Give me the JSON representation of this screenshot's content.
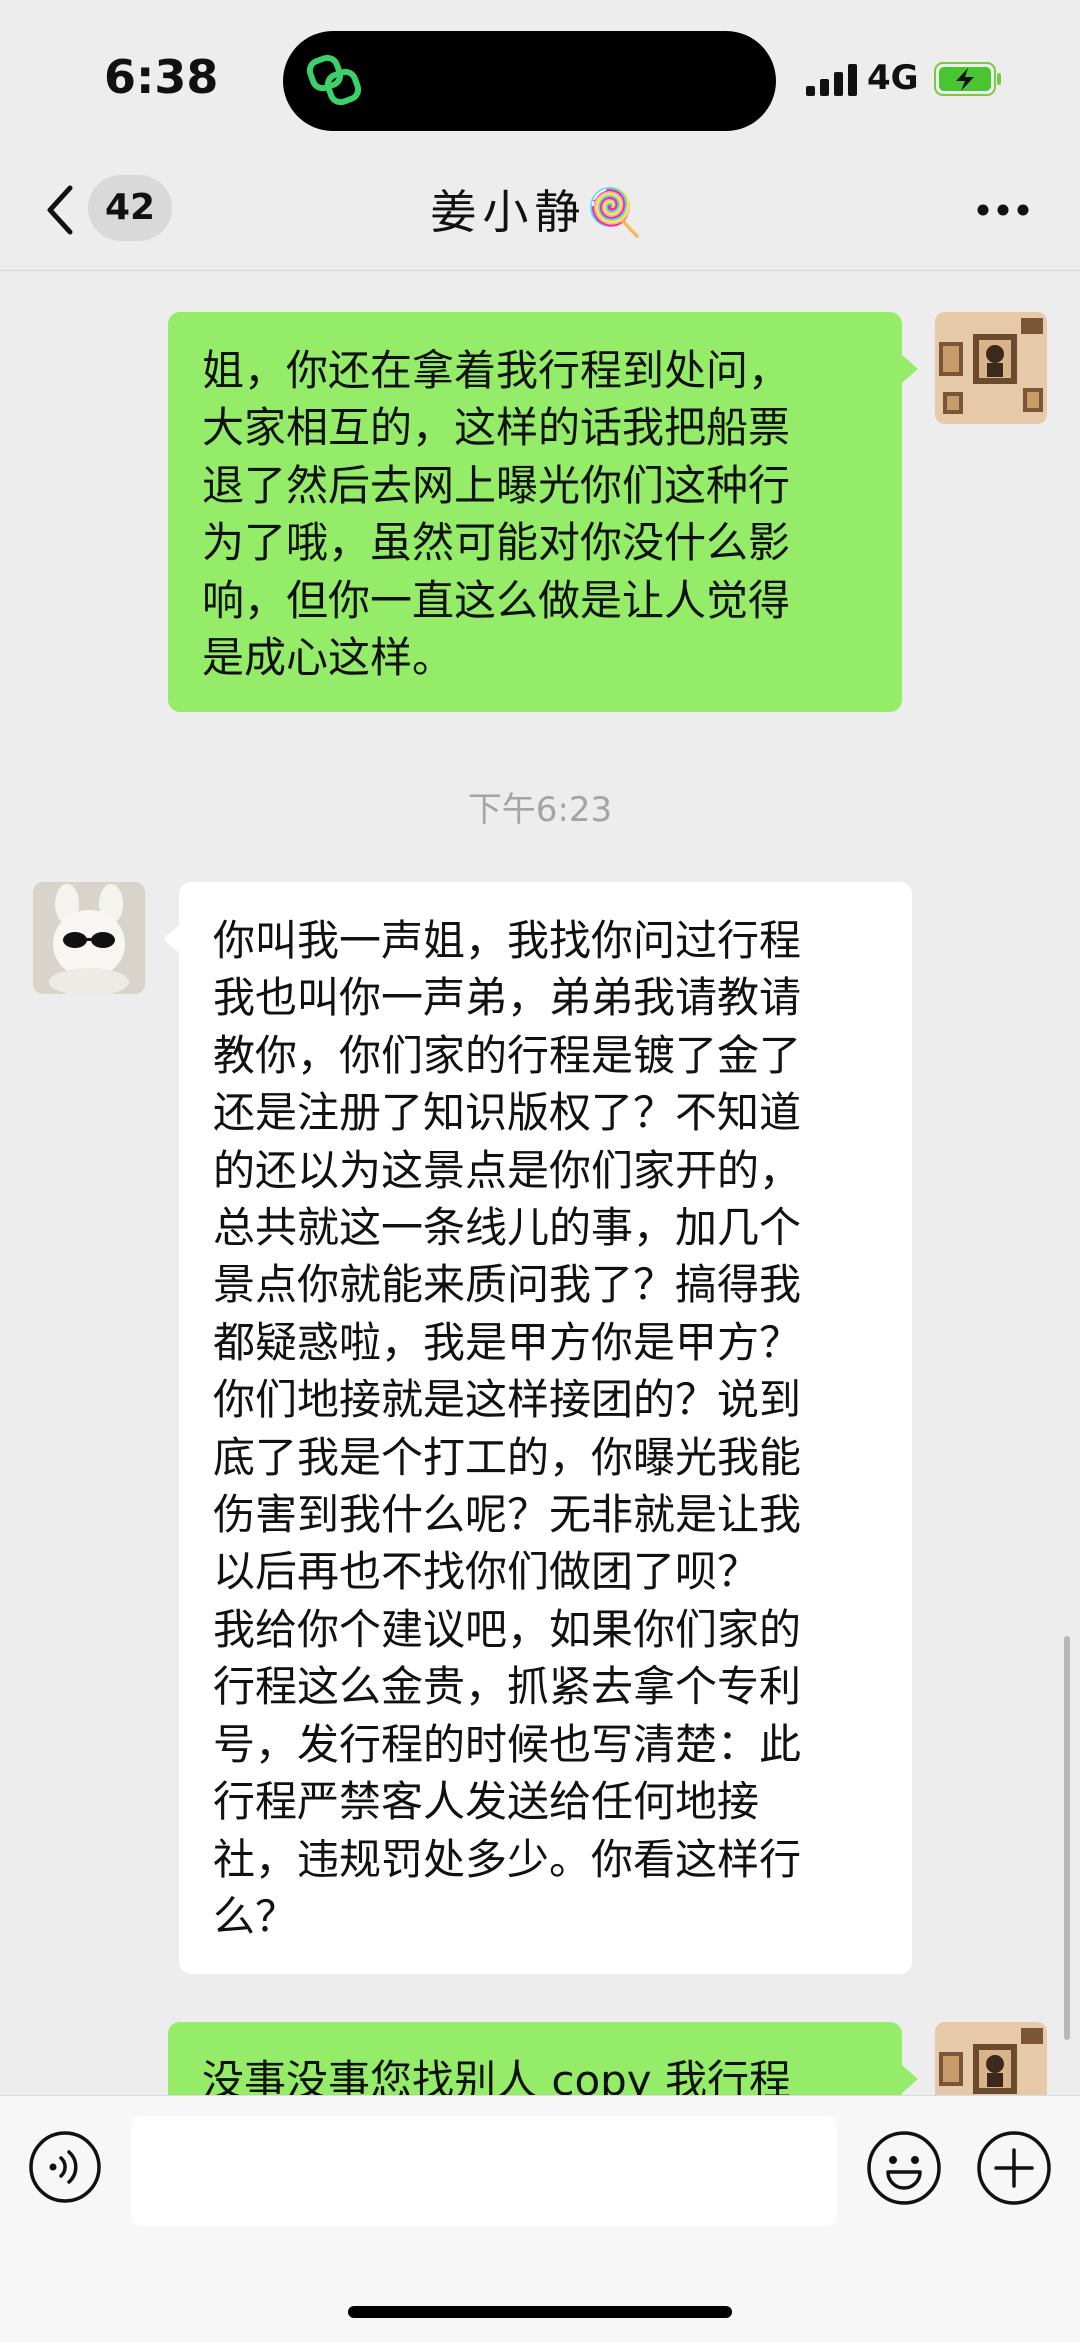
{
  "status_bar": {
    "time": "6:38",
    "network": "4G"
  },
  "nav": {
    "unread_count": "42",
    "title": "姜小静🍭"
  },
  "timestamp": "下午6:23",
  "messages": [
    {
      "direction": "out",
      "text": "姐，你还在拿着我行程到处问，\n大家相互的，这样的话我把船票\n退了然后去网上曝光你们这种行\n为了哦，虽然可能对你没什么影\n响，但你一直这么做是让人觉得\n是成心这样。"
    },
    {
      "direction": "in",
      "text": "你叫我一声姐，我找你问过行程\n我也叫你一声弟，弟弟我请教请\n教你，你们家的行程是镀了金了\n还是注册了知识版权了？不知道\n的还以为这景点是你们家开的，\n总共就这一条线儿的事，加几个\n景点你就能来质问我了？搞得我\n都疑惑啦，我是甲方你是甲方？\n你们地接就是这样接团的？说到\n底了我是个打工的，你曝光我能\n伤害到我什么呢？无非就是让我\n以后再也不找你们做团了呗？\n我给你个建议吧，如果你们家的\n行程这么金贵，抓紧去拿个专利\n号，发行程的时候也写清楚：此\n行程严禁客人发送给任何地接\n社，违规罚处多少。你看这样行\n么？"
    },
    {
      "direction": "out",
      "text": "没事没事您找别人 copy 我行程"
    }
  ],
  "colors": {
    "out_bubble": "#95ec69",
    "in_bubble": "#ffffff",
    "background": "#ededed"
  },
  "icons": [
    "chevron-left-icon",
    "more-icon",
    "voice-icon",
    "emoji-icon",
    "plus-icon",
    "signal-icon",
    "battery-charging-icon"
  ]
}
